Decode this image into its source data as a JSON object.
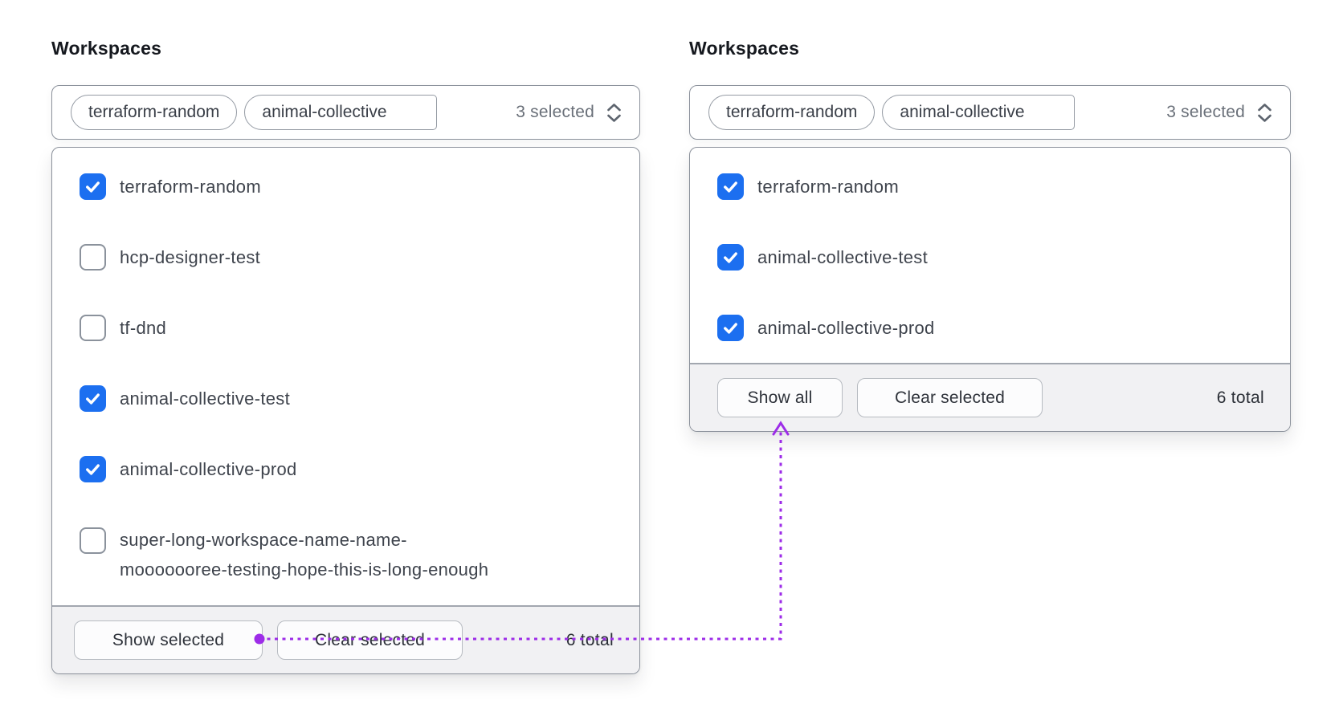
{
  "accent": {
    "checkbox_blue": "#1c6ff0",
    "annotation_purple": "#9d2ce8"
  },
  "left_panel": {
    "title": "Workspaces",
    "select": {
      "tags": [
        "terraform-random",
        "animal-collective"
      ],
      "summary": "3 selected"
    },
    "options": [
      {
        "label": "terraform-random",
        "checked": true
      },
      {
        "label": "hcp-designer-test",
        "checked": false
      },
      {
        "label": "tf-dnd",
        "checked": false
      },
      {
        "label": "animal-collective-test",
        "checked": true
      },
      {
        "label": "animal-collective-prod",
        "checked": true
      },
      {
        "label": "super-long-workspace-name-name-\nmooooooree-testing-hope-this-is-long-enough",
        "checked": false
      }
    ],
    "footer": {
      "show_button": "Show selected",
      "clear_button": "Clear selected",
      "total": "6 total"
    }
  },
  "right_panel": {
    "title": "Workspaces",
    "select": {
      "tags": [
        "terraform-random",
        "animal-collective"
      ],
      "summary": "3 selected"
    },
    "options": [
      {
        "label": "terraform-random",
        "checked": true
      },
      {
        "label": "animal-collective-test",
        "checked": true
      },
      {
        "label": "animal-collective-prod",
        "checked": true
      }
    ],
    "footer": {
      "show_button": "Show all",
      "clear_button": "Clear selected",
      "total": "6 total"
    }
  }
}
